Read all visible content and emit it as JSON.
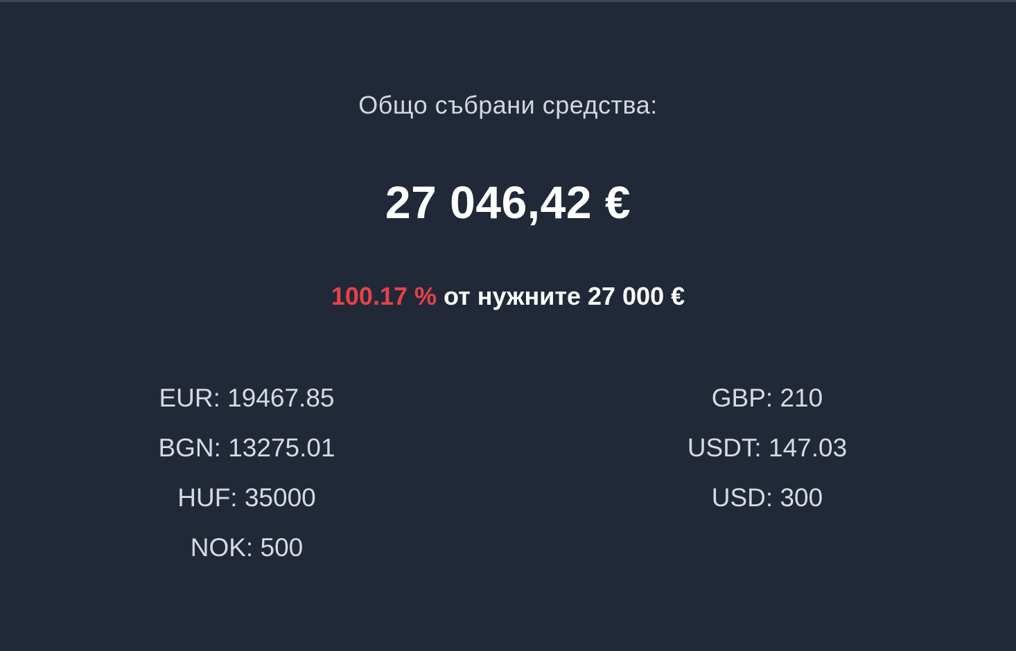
{
  "heading": "Общо събрани средства:",
  "total": "27 046,42 €",
  "progress": {
    "percent_text": "100.17 %",
    "goal_text": " от нужните 27 000 €",
    "percent_value": 100.17,
    "accent_color": "#e8414a"
  },
  "colors": {
    "background": "#212938",
    "text": "#d6dbe2",
    "emphasis": "#ffffff"
  },
  "currencies": {
    "left": [
      {
        "label": "EUR: 19467.85"
      },
      {
        "label": "BGN: 13275.01"
      },
      {
        "label": "HUF: 35000"
      },
      {
        "label": "NOK: 500"
      }
    ],
    "right": [
      {
        "label": "GBP: 210"
      },
      {
        "label": "USDT: 147.03"
      },
      {
        "label": "USD: 300"
      }
    ]
  }
}
